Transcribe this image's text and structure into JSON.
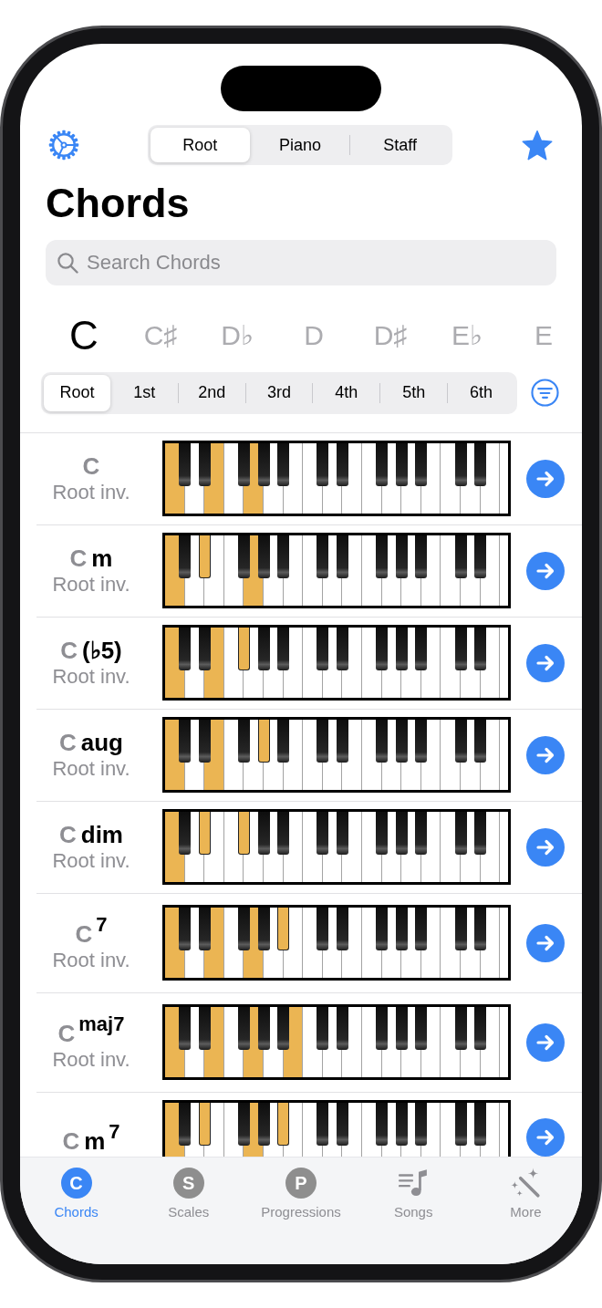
{
  "view_tabs": [
    {
      "label": "Root",
      "selected": true
    },
    {
      "label": "Piano",
      "selected": false
    },
    {
      "label": "Staff",
      "selected": false
    }
  ],
  "title": "Chords",
  "search": {
    "placeholder": "Search Chords"
  },
  "keys": [
    {
      "label": "C",
      "selected": true
    },
    {
      "label": "C♯",
      "selected": false
    },
    {
      "label": "D♭",
      "selected": false
    },
    {
      "label": "D",
      "selected": false
    },
    {
      "label": "D♯",
      "selected": false
    },
    {
      "label": "E♭",
      "selected": false
    },
    {
      "label": "E",
      "selected": false
    }
  ],
  "inversions": [
    {
      "label": "Root",
      "selected": true
    },
    {
      "label": "1st",
      "selected": false
    },
    {
      "label": "2nd",
      "selected": false
    },
    {
      "label": "3rd",
      "selected": false
    },
    {
      "label": "4th",
      "selected": false
    },
    {
      "label": "5th",
      "selected": false
    },
    {
      "label": "6th",
      "selected": false
    }
  ],
  "chords": [
    {
      "root": "C",
      "subtitle": "Root inv.",
      "piano": {
        "white_keys": [
          {
            "on": true
          },
          {
            "on": false
          },
          {
            "on": true
          },
          {
            "on": false
          },
          {
            "on": true
          },
          {
            "on": false
          },
          {
            "on": false
          },
          {
            "on": false
          },
          {
            "on": false
          },
          {
            "on": false
          },
          {
            "on": false
          },
          {
            "on": false
          },
          {
            "on": false
          },
          {
            "on": false
          },
          {
            "on": false
          },
          {
            "on": false
          },
          {
            "on": false
          },
          {
            "on": false
          }
        ],
        "black_keys": [
          {
            "on": false
          },
          {
            "on": false
          },
          {
            "on": false
          },
          {
            "on": false
          },
          {
            "on": false
          },
          {
            "on": false
          },
          {
            "on": false
          },
          {
            "on": false
          },
          {
            "on": false
          },
          {
            "on": false
          },
          {
            "on": false
          },
          {
            "on": false
          }
        ]
      }
    },
    {
      "root": "C",
      "quality": "m",
      "subtitle": "Root inv.",
      "piano": {
        "white_keys": [
          {
            "on": true
          },
          {
            "on": false
          },
          {
            "on": false
          },
          {
            "on": false
          },
          {
            "on": true
          },
          {
            "on": false
          },
          {
            "on": false
          },
          {
            "on": false
          },
          {
            "on": false
          },
          {
            "on": false
          },
          {
            "on": false
          },
          {
            "on": false
          },
          {
            "on": false
          },
          {
            "on": false
          },
          {
            "on": false
          },
          {
            "on": false
          },
          {
            "on": false
          },
          {
            "on": false
          }
        ],
        "black_keys": [
          {
            "on": false
          },
          {
            "on": true
          },
          {
            "on": false
          },
          {
            "on": false
          },
          {
            "on": false
          },
          {
            "on": false
          },
          {
            "on": false
          },
          {
            "on": false
          },
          {
            "on": false
          },
          {
            "on": false
          },
          {
            "on": false
          },
          {
            "on": false
          }
        ]
      }
    },
    {
      "root": "C",
      "quality": "(♭5)",
      "subtitle": "Root inv.",
      "piano": {
        "white_keys": [
          {
            "on": true
          },
          {
            "on": false
          },
          {
            "on": true
          },
          {
            "on": false
          },
          {
            "on": false
          },
          {
            "on": false
          },
          {
            "on": false
          },
          {
            "on": false
          },
          {
            "on": false
          },
          {
            "on": false
          },
          {
            "on": false
          },
          {
            "on": false
          },
          {
            "on": false
          },
          {
            "on": false
          },
          {
            "on": false
          },
          {
            "on": false
          },
          {
            "on": false
          },
          {
            "on": false
          }
        ],
        "black_keys": [
          {
            "on": false
          },
          {
            "on": false
          },
          {
            "on": true
          },
          {
            "on": false
          },
          {
            "on": false
          },
          {
            "on": false
          },
          {
            "on": false
          },
          {
            "on": false
          },
          {
            "on": false
          },
          {
            "on": false
          },
          {
            "on": false
          },
          {
            "on": false
          }
        ]
      }
    },
    {
      "root": "C",
      "quality": "aug",
      "subtitle": "Root inv.",
      "piano": {
        "white_keys": [
          {
            "on": true
          },
          {
            "on": false
          },
          {
            "on": true
          },
          {
            "on": false
          },
          {
            "on": false
          },
          {
            "on": false
          },
          {
            "on": false
          },
          {
            "on": false
          },
          {
            "on": false
          },
          {
            "on": false
          },
          {
            "on": false
          },
          {
            "on": false
          },
          {
            "on": false
          },
          {
            "on": false
          },
          {
            "on": false
          },
          {
            "on": false
          },
          {
            "on": false
          },
          {
            "on": false
          }
        ],
        "black_keys": [
          {
            "on": false
          },
          {
            "on": false
          },
          {
            "on": false
          },
          {
            "on": true
          },
          {
            "on": false
          },
          {
            "on": false
          },
          {
            "on": false
          },
          {
            "on": false
          },
          {
            "on": false
          },
          {
            "on": false
          },
          {
            "on": false
          },
          {
            "on": false
          }
        ]
      }
    },
    {
      "root": "C",
      "quality": "dim",
      "subtitle": "Root inv.",
      "piano": {
        "white_keys": [
          {
            "on": true
          },
          {
            "on": false
          },
          {
            "on": false
          },
          {
            "on": false
          },
          {
            "on": false
          },
          {
            "on": false
          },
          {
            "on": false
          },
          {
            "on": false
          },
          {
            "on": false
          },
          {
            "on": false
          },
          {
            "on": false
          },
          {
            "on": false
          },
          {
            "on": false
          },
          {
            "on": false
          },
          {
            "on": false
          },
          {
            "on": false
          },
          {
            "on": false
          },
          {
            "on": false
          }
        ],
        "black_keys": [
          {
            "on": false
          },
          {
            "on": true
          },
          {
            "on": true
          },
          {
            "on": false
          },
          {
            "on": false
          },
          {
            "on": false
          },
          {
            "on": false
          },
          {
            "on": false
          },
          {
            "on": false
          },
          {
            "on": false
          },
          {
            "on": false
          },
          {
            "on": false
          }
        ]
      }
    },
    {
      "root": "C",
      "superscript": "7",
      "subtitle": "Root inv.",
      "piano": {
        "white_keys": [
          {
            "on": true
          },
          {
            "on": false
          },
          {
            "on": true
          },
          {
            "on": false
          },
          {
            "on": true
          },
          {
            "on": false
          },
          {
            "on": false
          },
          {
            "on": false
          },
          {
            "on": false
          },
          {
            "on": false
          },
          {
            "on": false
          },
          {
            "on": false
          },
          {
            "on": false
          },
          {
            "on": false
          },
          {
            "on": false
          },
          {
            "on": false
          },
          {
            "on": false
          },
          {
            "on": false
          }
        ],
        "black_keys": [
          {
            "on": false
          },
          {
            "on": false
          },
          {
            "on": false
          },
          {
            "on": false
          },
          {
            "on": true
          },
          {
            "on": false
          },
          {
            "on": false
          },
          {
            "on": false
          },
          {
            "on": false
          },
          {
            "on": false
          },
          {
            "on": false
          },
          {
            "on": false
          }
        ]
      }
    },
    {
      "root": "C",
      "superscript": "maj7",
      "subtitle": "Root inv.",
      "piano": {
        "white_keys": [
          {
            "on": true
          },
          {
            "on": false
          },
          {
            "on": true
          },
          {
            "on": false
          },
          {
            "on": true
          },
          {
            "on": false
          },
          {
            "on": true
          },
          {
            "on": false
          },
          {
            "on": false
          },
          {
            "on": false
          },
          {
            "on": false
          },
          {
            "on": false
          },
          {
            "on": false
          },
          {
            "on": false
          },
          {
            "on": false
          },
          {
            "on": false
          },
          {
            "on": false
          },
          {
            "on": false
          }
        ],
        "black_keys": [
          {
            "on": false
          },
          {
            "on": false
          },
          {
            "on": false
          },
          {
            "on": false
          },
          {
            "on": false
          },
          {
            "on": false
          },
          {
            "on": false
          },
          {
            "on": false
          },
          {
            "on": false
          },
          {
            "on": false
          },
          {
            "on": false
          },
          {
            "on": false
          }
        ]
      }
    },
    {
      "root": "C",
      "quality": "m",
      "superscript": "7",
      "piano": {
        "white_keys": [
          {
            "on": true
          },
          {
            "on": false
          },
          {
            "on": false
          },
          {
            "on": false
          },
          {
            "on": true
          },
          {
            "on": false
          },
          {
            "on": false
          },
          {
            "on": false
          },
          {
            "on": false
          },
          {
            "on": false
          },
          {
            "on": false
          },
          {
            "on": false
          },
          {
            "on": false
          },
          {
            "on": false
          },
          {
            "on": false
          },
          {
            "on": false
          },
          {
            "on": false
          },
          {
            "on": false
          }
        ],
        "black_keys": [
          {
            "on": false
          },
          {
            "on": true
          },
          {
            "on": false
          },
          {
            "on": false
          },
          {
            "on": true
          },
          {
            "on": false
          },
          {
            "on": false
          },
          {
            "on": false
          },
          {
            "on": false
          },
          {
            "on": false
          },
          {
            "on": false
          },
          {
            "on": false
          }
        ]
      }
    }
  ],
  "tab_bar": [
    {
      "kind": "letter",
      "letter": "C",
      "label": "Chords",
      "selected": true
    },
    {
      "kind": "letter",
      "letter": "S",
      "label": "Scales",
      "selected": false
    },
    {
      "kind": "letter",
      "letter": "P",
      "label": "Progressions",
      "selected": false
    },
    {
      "kind": "music",
      "label": "Songs",
      "selected": false
    },
    {
      "kind": "wand",
      "label": "More",
      "selected": false
    }
  ]
}
